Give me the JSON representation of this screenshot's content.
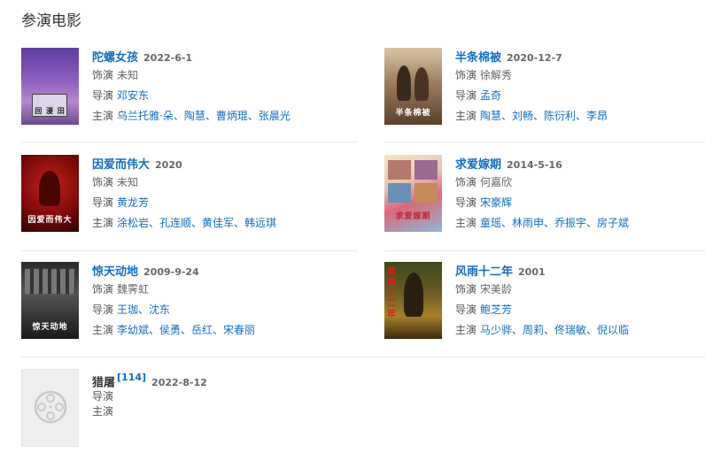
{
  "section": {
    "title": "参演电影"
  },
  "movies": [
    {
      "title": "陀螺女孩",
      "date": "2022-6-1",
      "role_label": "饰演",
      "role": "未知",
      "director_label": "导演",
      "director": "邓安东",
      "cast_label": "主演",
      "cast": "乌兰托雅·朵、陶慧、曹炳琨、张晨光",
      "poster_text": "回 漫 田"
    },
    {
      "title": "半条棉被",
      "date": "2020-12-7",
      "role_label": "饰演",
      "role": "徐解秀",
      "director_label": "导演",
      "director": "孟奇",
      "cast_label": "主演",
      "cast": "陶慧、刘畅、陈衍利、李昂",
      "poster_text": "半条棉被"
    },
    {
      "title": "因爱而伟大",
      "date": "2020",
      "role_label": "饰演",
      "role": "未知",
      "director_label": "导演",
      "director": "黄龙芳",
      "cast_label": "主演",
      "cast": "涂松岩、孔连顺、黄佳军、韩远琪",
      "poster_text": "因爱而伟大"
    },
    {
      "title": "求爱嫁期",
      "date": "2014-5-16",
      "role_label": "饰演",
      "role": "何嘉欣",
      "director_label": "导演",
      "director": "宋豪辉",
      "cast_label": "主演",
      "cast": "童瑶、林雨申、乔振宇、房子斌",
      "poster_text": "求爱嫁期"
    },
    {
      "title": "惊天动地",
      "date": "2009-9-24",
      "role_label": "饰演",
      "role": "魏霁虹",
      "director_label": "导演",
      "director": "王珈、沈东",
      "cast_label": "主演",
      "cast": "李幼斌、侯勇、岳红、宋春丽",
      "poster_text": "惊天动地"
    },
    {
      "title": "风雨十二年",
      "date": "2001",
      "role_label": "饰演",
      "role": "宋美龄",
      "director_label": "导演",
      "director": "鲍芝芳",
      "cast_label": "主演",
      "cast": "马少骅、周莉、佟瑞敏、倪以临",
      "poster_text": "風雨十二年"
    },
    {
      "title": "猎屠",
      "citation": "[114]",
      "date": "2022-8-12",
      "director_label": "导演",
      "cast_label": "主演"
    }
  ],
  "colors": {
    "link": "#136ec2",
    "divider": "#e8e8e8"
  }
}
